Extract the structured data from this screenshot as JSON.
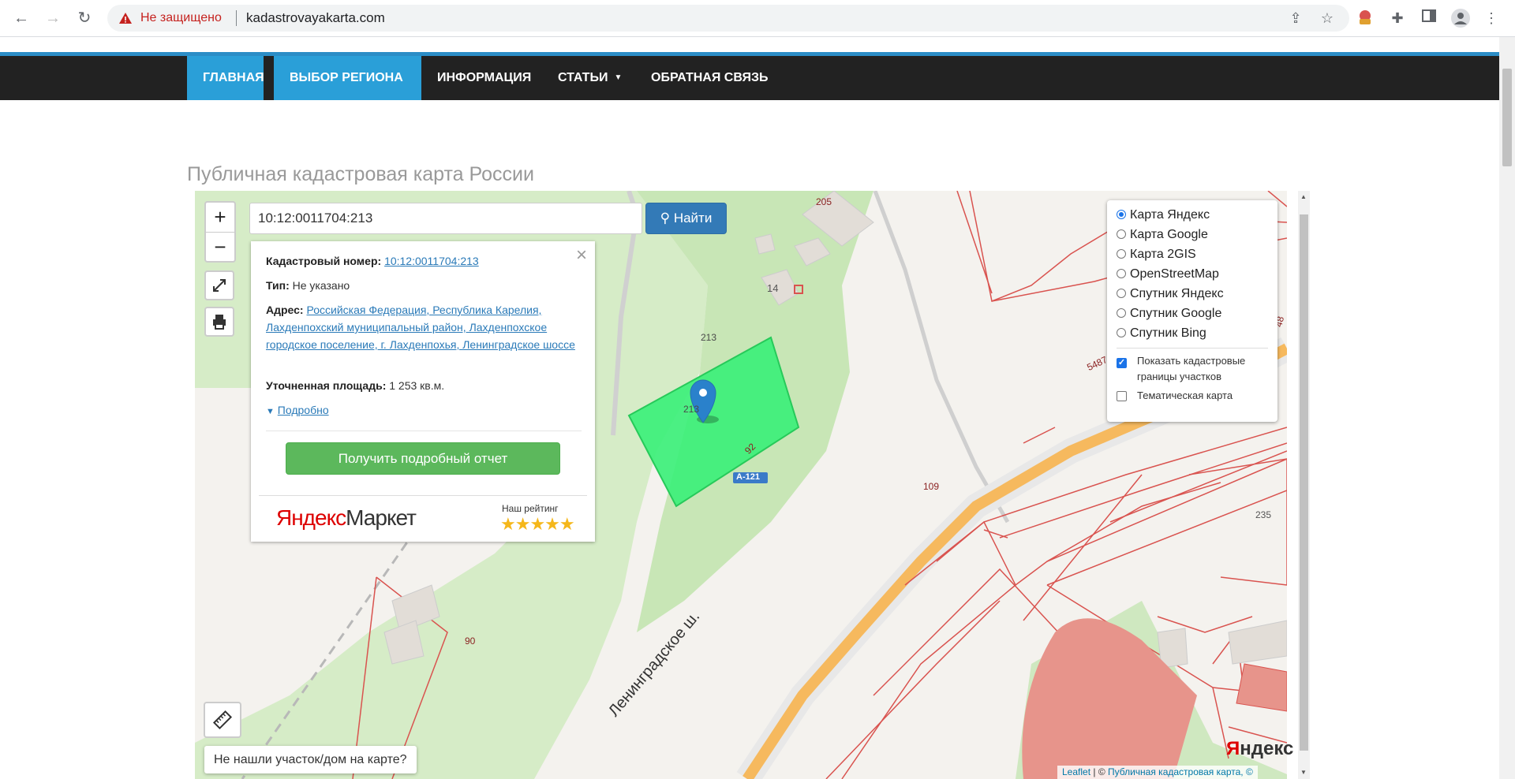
{
  "browser": {
    "security_status": "Не защищено",
    "url": "kadastrovayakarta.com"
  },
  "nav": {
    "items": [
      {
        "label": "ГЛАВНАЯ"
      },
      {
        "label": "ВЫБОР РЕГИОНА"
      },
      {
        "label": "ИНФОРМАЦИЯ"
      },
      {
        "label": "СТАТЬИ"
      },
      {
        "label": "ОБРАТНАЯ СВЯЗЬ"
      }
    ]
  },
  "page": {
    "title": "Публичная кадастровая карта России"
  },
  "search": {
    "value": "10:12:0011704:213",
    "button_label": "Найти"
  },
  "zoom": {
    "in": "+",
    "out": "−"
  },
  "popup": {
    "cad_label": "Кадастровый номер:",
    "cad_value": "10:12:0011704:213",
    "type_label": "Тип:",
    "type_value": "Не указано",
    "address_label": "Адрес:",
    "address_value": "Российская Федерация, Республика Карелия, Лахденпохский муниципальный район, Лахденпохское городское поселение, г. Лахденпохья, Ленинградское шоссе",
    "area_label": "Уточненная площадь:",
    "area_value": "1 253 кв.м.",
    "details_link": "Подробно",
    "report_button": "Получить подробный отчет",
    "market_logo_ya": "Яндекс",
    "market_logo_rest": "Маркет",
    "rating_label": "Наш рейтинг",
    "stars": "★★★★★"
  },
  "layers": {
    "options": [
      {
        "label": "Карта Яндекс",
        "selected": true
      },
      {
        "label": "Карта Google",
        "selected": false
      },
      {
        "label": "Карта 2GIS",
        "selected": false
      },
      {
        "label": "OpenStreetMap",
        "selected": false
      },
      {
        "label": "Спутник Яндекс",
        "selected": false
      },
      {
        "label": "Спутник Google",
        "selected": false
      },
      {
        "label": "Спутник Bing",
        "selected": false
      }
    ],
    "show_borders_label": "Показать кадастровые границы участков",
    "show_borders_checked": true,
    "thematic_label": "Тематическая карта",
    "thematic_checked": false
  },
  "map": {
    "labels": {
      "parcel_top": "213",
      "parcel_bottom": "213",
      "house_205": "205",
      "house_14": "14",
      "n5487": "5487",
      "n92": "92",
      "road_badge": "A-121",
      "n109": "109",
      "n235": "235",
      "n90": "90",
      "n48": "48",
      "road_name": "Ленинградское ш."
    },
    "not_found": "Не нашли участок/дом на карте?",
    "attribution_leaflet": "Leaflet",
    "attribution_sep": " | © ",
    "attribution_pkk": "Публичная кадастровая карта, ©",
    "logo_ya": "Я",
    "logo_rest": "ндекс"
  },
  "colors": {
    "nav_bg": "#222222",
    "nav_active": "#2a9fd8",
    "search_btn": "#337ab7",
    "report_btn": "#5cb85c",
    "parcel_fill": "#3cf07a",
    "parcel_line": "#d9534f"
  }
}
